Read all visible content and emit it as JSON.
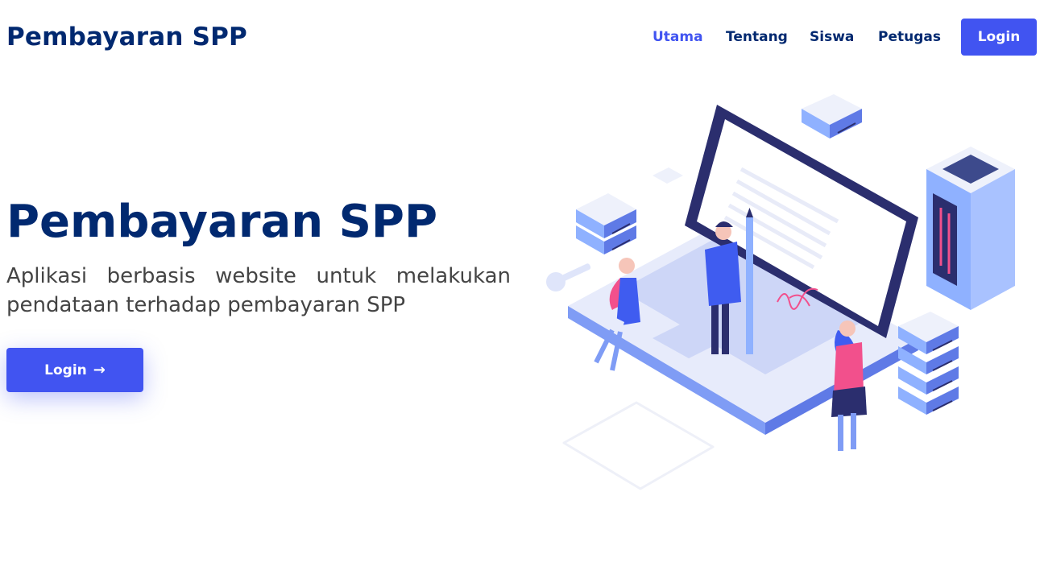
{
  "header": {
    "logo": "Pembayaran SPP",
    "nav": [
      {
        "label": "Utama",
        "active": true
      },
      {
        "label": "Tentang",
        "active": false
      },
      {
        "label": "Siswa",
        "active": false
      },
      {
        "label": "Petugas",
        "active": false
      }
    ],
    "login_label": "Login"
  },
  "hero": {
    "title": "Pembayaran SPP",
    "subtitle": "Aplikasi berbasis website untuk melakukan pendataan terhadap pembayaran SPP",
    "button_label": "Login",
    "button_icon": "arrow-right-icon"
  },
  "colors": {
    "brand_dark": "#012970",
    "accent": "#4154f1",
    "text_muted": "#444444"
  }
}
